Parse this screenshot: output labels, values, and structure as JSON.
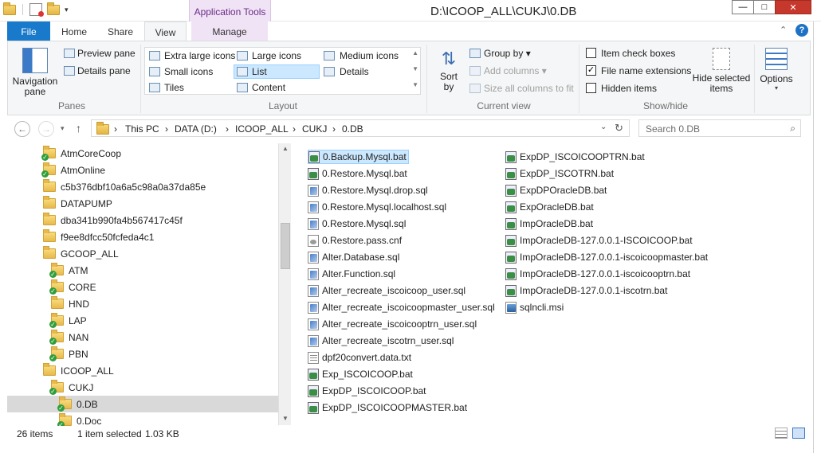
{
  "window": {
    "title": "D:\\ICOOP_ALL\\CUKJ\\0.DB",
    "context_tab_group": "Application Tools",
    "minimize": "—",
    "maximize": "□",
    "close": "✕"
  },
  "tabs": {
    "file": "File",
    "home": "Home",
    "share": "Share",
    "view": "View",
    "manage": "Manage"
  },
  "ribbon": {
    "panes": {
      "label": "Panes",
      "navigation_pane": "Navigation pane",
      "preview_pane": "Preview pane",
      "details_pane": "Details pane"
    },
    "layout": {
      "label": "Layout",
      "options": [
        "Extra large icons",
        "Large icons",
        "Medium icons",
        "Small icons",
        "List",
        "Details",
        "Tiles",
        "Content"
      ],
      "selected": "List"
    },
    "current_view": {
      "label": "Current view",
      "sort_by": "Sort by",
      "group_by": "Group by",
      "add_columns": "Add columns",
      "size_all_columns": "Size all columns to fit"
    },
    "show_hide": {
      "label": "Show/hide",
      "item_check_boxes": "Item check boxes",
      "item_check_boxes_checked": false,
      "file_name_extensions": "File name extensions",
      "file_name_extensions_checked": true,
      "hidden_items": "Hidden items",
      "hidden_items_checked": false,
      "hide_selected_items": "Hide selected items"
    },
    "options": "Options"
  },
  "address": {
    "crumbs": [
      "This PC",
      "DATA (D:)",
      "ICOOP_ALL",
      "CUKJ",
      "0.DB"
    ],
    "search_placeholder": "Search 0.DB"
  },
  "tree": [
    {
      "name": "AtmCoreCoop",
      "shared": true
    },
    {
      "name": "AtmOnline",
      "shared": true
    },
    {
      "name": "c5b376dbf10a6a5c98a0a37da85e",
      "shared": false
    },
    {
      "name": "DATAPUMP",
      "shared": false
    },
    {
      "name": "dba341b990fa4b567417c45f",
      "shared": false
    },
    {
      "name": "f9ee8dfcc50fcfeda4c1",
      "shared": false
    },
    {
      "name": "GCOOP_ALL",
      "shared": false
    },
    {
      "name": "ATM",
      "shared": true
    },
    {
      "name": "CORE",
      "shared": true
    },
    {
      "name": "HND",
      "shared": false
    },
    {
      "name": "LAP",
      "shared": true
    },
    {
      "name": "NAN",
      "shared": true
    },
    {
      "name": "PBN",
      "shared": true
    },
    {
      "name": "ICOOP_ALL",
      "shared": false
    },
    {
      "name": "CUKJ",
      "shared": true
    },
    {
      "name": "0.DB",
      "shared": true
    },
    {
      "name": "0.Doc",
      "shared": true
    }
  ],
  "files_col1": [
    {
      "name": "0.Backup.Mysql.bat",
      "type": "bat"
    },
    {
      "name": "0.Restore.Mysql.bat",
      "type": "bat"
    },
    {
      "name": "0.Restore.Mysql.drop.sql",
      "type": "sql"
    },
    {
      "name": "0.Restore.Mysql.localhost.sql",
      "type": "sql"
    },
    {
      "name": "0.Restore.Mysql.sql",
      "type": "sql"
    },
    {
      "name": "0.Restore.pass.cnf",
      "type": "cnf"
    },
    {
      "name": "Alter.Database.sql",
      "type": "sql"
    },
    {
      "name": "Alter.Function.sql",
      "type": "sql"
    },
    {
      "name": "Alter_recreate_iscoicoop_user.sql",
      "type": "sql"
    },
    {
      "name": "Alter_recreate_iscoicoopmaster_user.sql",
      "type": "sql"
    },
    {
      "name": "Alter_recreate_iscoicooptrn_user.sql",
      "type": "sql"
    },
    {
      "name": "Alter_recreate_iscotrn_user.sql",
      "type": "sql"
    },
    {
      "name": "dpf20convert.data.txt",
      "type": "txt"
    },
    {
      "name": "Exp_ISCOICOOP.bat",
      "type": "bat"
    },
    {
      "name": "ExpDP_ISCOICOOP.bat",
      "type": "bat"
    },
    {
      "name": "ExpDP_ISCOICOOPMASTER.bat",
      "type": "bat"
    }
  ],
  "files_col2": [
    {
      "name": "ExpDP_ISCOICOOPTRN.bat",
      "type": "bat"
    },
    {
      "name": "ExpDP_ISCOTRN.bat",
      "type": "bat"
    },
    {
      "name": "ExpDPOracleDB.bat",
      "type": "bat"
    },
    {
      "name": "ExpOracleDB.bat",
      "type": "bat"
    },
    {
      "name": "ImpOracleDB.bat",
      "type": "bat"
    },
    {
      "name": "ImpOracleDB-127.0.0.1-ISCOICOOP.bat",
      "type": "bat"
    },
    {
      "name": "ImpOracleDB-127.0.0.1-iscoicoopmaster.bat",
      "type": "bat"
    },
    {
      "name": "ImpOracleDB-127.0.0.1-iscoicooptrn.bat",
      "type": "bat"
    },
    {
      "name": "ImpOracleDB-127.0.0.1-iscotrn.bat",
      "type": "bat"
    },
    {
      "name": "sqlncli.msi",
      "type": "msi"
    }
  ],
  "status": {
    "items": "26 items",
    "selected": "1 item selected",
    "size": "1.03 KB"
  }
}
